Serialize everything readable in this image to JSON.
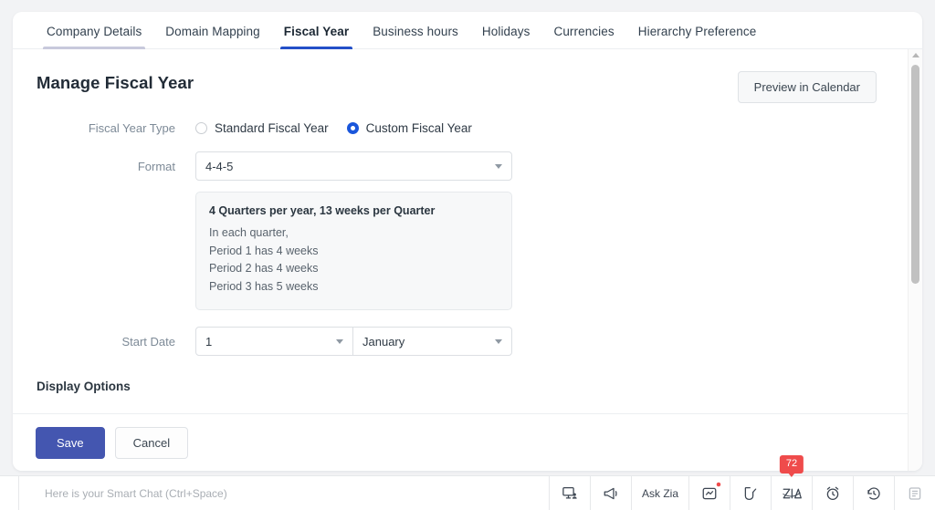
{
  "tabs": [
    {
      "label": "Company Details",
      "state": "hovered"
    },
    {
      "label": "Domain Mapping",
      "state": "default"
    },
    {
      "label": "Fiscal Year",
      "state": "active"
    },
    {
      "label": "Business hours",
      "state": "default"
    },
    {
      "label": "Holidays",
      "state": "default"
    },
    {
      "label": "Currencies",
      "state": "default"
    },
    {
      "label": "Hierarchy Preference",
      "state": "default"
    }
  ],
  "page": {
    "title": "Manage Fiscal Year",
    "preview_button": "Preview in Calendar"
  },
  "form": {
    "fiscal_year_type": {
      "label": "Fiscal Year Type",
      "options": [
        {
          "label": "Standard Fiscal Year",
          "selected": false
        },
        {
          "label": "Custom Fiscal Year",
          "selected": true
        }
      ]
    },
    "format": {
      "label": "Format",
      "value": "4-4-5"
    },
    "info": {
      "title": "4 Quarters per year, 13 weeks per Quarter",
      "lines": [
        "In each quarter,",
        "Period 1 has 4 weeks",
        "Period 2 has 4 weeks",
        "Period 3 has 5 weeks"
      ]
    },
    "start_date": {
      "label": "Start Date",
      "day": "1",
      "month": "January"
    },
    "display_options_title": "Display Options"
  },
  "footer": {
    "save_label": "Save",
    "cancel_label": "Cancel"
  },
  "bottombar": {
    "chat_placeholder": "Here is your Smart Chat (Ctrl+Space)",
    "ask_zia_label": "Ask Zia",
    "zia_badge": "72",
    "icons": [
      "presentation-screen-icon",
      "megaphone-icon",
      "chart-note-icon",
      "cursor-click-icon",
      "zia-logo-icon",
      "alarm-clock-icon",
      "history-clock-icon",
      "archive-box-icon"
    ]
  },
  "colors": {
    "accent_blue": "#2450c8",
    "radio_blue": "#1a56db",
    "save_indigo": "#4456b0",
    "badge_red": "#ef4b4b",
    "tab_hover": "#c8c9dc"
  }
}
